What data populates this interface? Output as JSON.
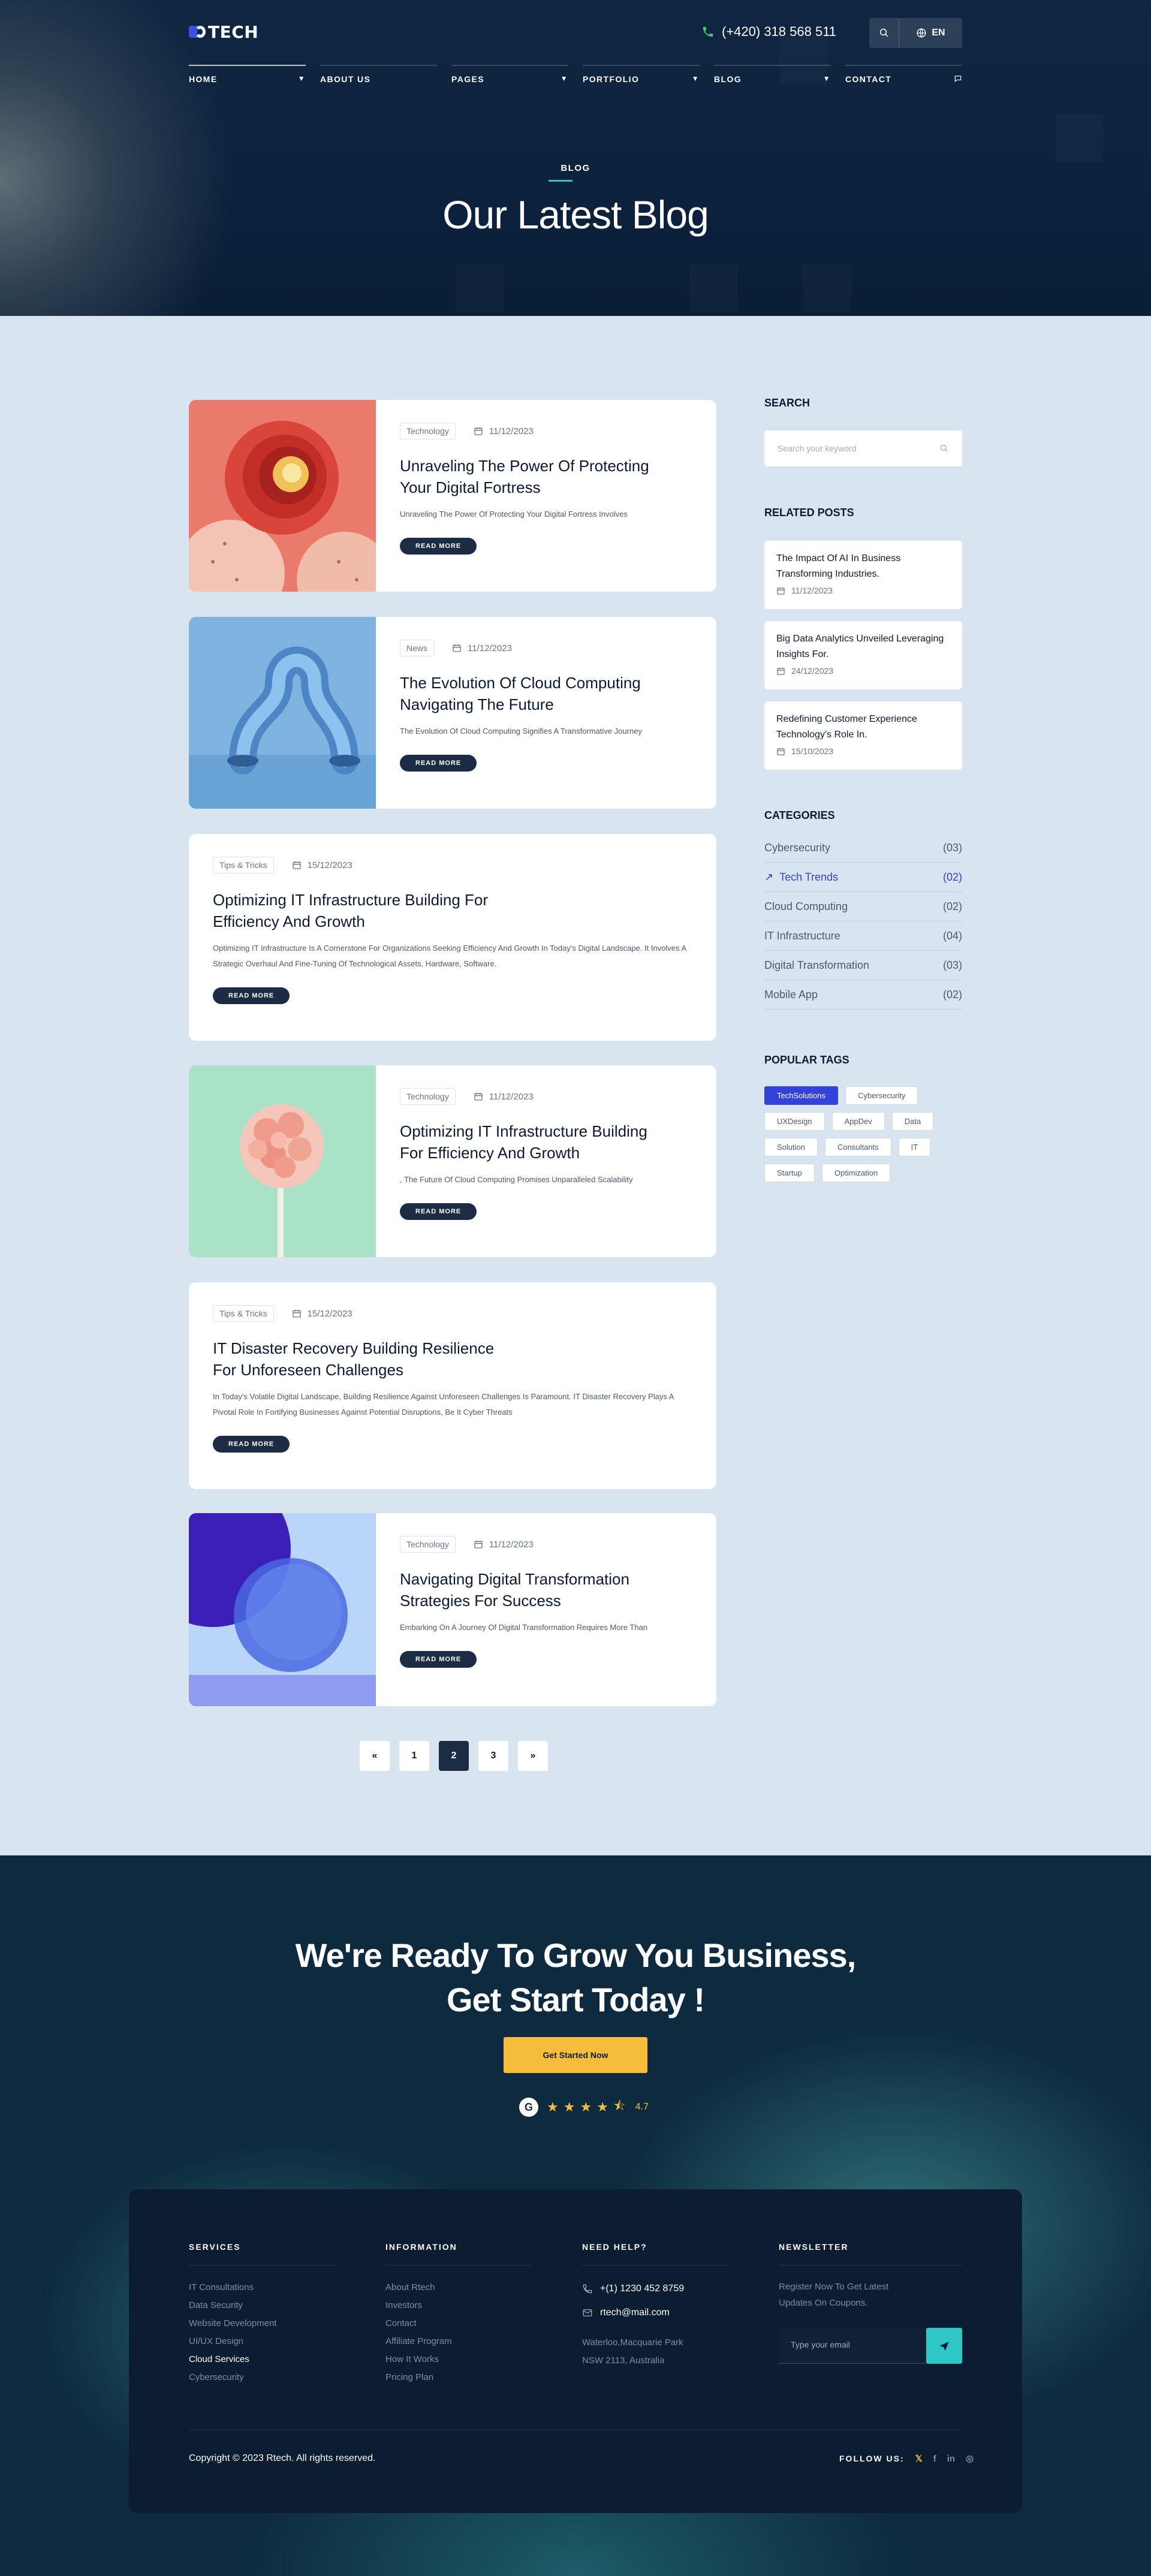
{
  "header": {
    "logo_text": "TECH",
    "phone": "(+420) 318 568 511",
    "lang": "EN",
    "nav": [
      {
        "label": "HOME",
        "dropdown": true
      },
      {
        "label": "ABOUT US",
        "dropdown": false
      },
      {
        "label": "PAGES",
        "dropdown": true
      },
      {
        "label": "PORTFOLIO",
        "dropdown": true
      },
      {
        "label": "BLOG",
        "dropdown": true
      },
      {
        "label": "CONTACT",
        "dropdown": false
      }
    ]
  },
  "hero": {
    "kicker": "BLOG",
    "title": "Our Latest Blog"
  },
  "posts": [
    {
      "tag": "Technology",
      "date": "11/12/2023",
      "title": "Unraveling The Power Of Protecting Your Digital Fortress",
      "desc": "Unraveling The Power Of Protecting Your Digital Fortress Involves",
      "btn": "READ MORE"
    },
    {
      "tag": "News",
      "date": "11/12/2023",
      "title": "The Evolution Of Cloud Computing Navigating The Future",
      "desc": "The Evolution Of Cloud Computing Signifies A Transformative Journey",
      "btn": "READ MORE"
    },
    {
      "tag": "Tips & Tricks",
      "date": "15/12/2023",
      "title": "Optimizing IT Infrastructure Building For Efficiency And Growth",
      "desc": "Optimizing IT Infrastructure Is A Cornerstone For Organizations Seeking Efficiency And Growth In Today's Digital Landscape. It Involves A Strategic Overhaul And Fine-Tuning Of Technological Assets, Hardware, Software.",
      "btn": "READ MORE"
    },
    {
      "tag": "Technology",
      "date": "11/12/2023",
      "title": "Optimizing IT Infrastructure Building For Efficiency And Growth",
      "desc": ", The Future Of Cloud Computing Promises Unparalleled Scalability",
      "btn": "READ MORE"
    },
    {
      "tag": "Tips & Tricks",
      "date": "15/12/2023",
      "title": "IT Disaster Recovery Building Resilience For Unforeseen Challenges",
      "desc": "In Today's Volatile Digital Landscape, Building Resilience Against Unforeseen Challenges Is Paramount. IT Disaster Recovery Plays A Pivotal Role In Fortifying Businesses Against Potential Disruptions, Be It Cyber Threats",
      "btn": "READ MORE"
    },
    {
      "tag": "Technology",
      "date": "11/12/2023",
      "title": "Navigating Digital Transformation Strategies For Success",
      "desc": "Embarking On A Journey Of Digital Transformation Requires More Than",
      "btn": "READ MORE"
    }
  ],
  "pagination": {
    "prev": "«",
    "pages": [
      "1",
      "2",
      "3"
    ],
    "current": "2",
    "next": "»"
  },
  "sidebar": {
    "search_title": "SEARCH",
    "search_placeholder": "Search your keyword",
    "related_title": "RELATED POSTS",
    "related": [
      {
        "title": "The Impact Of AI In Business Transforming Industries.",
        "date": "11/12/2023"
      },
      {
        "title": "Big Data Analytics Unveiled Leveraging Insights For.",
        "date": "24/12/2023"
      },
      {
        "title": "Redefining Customer Experience Technology's Role In.",
        "date": "15/10/2023"
      }
    ],
    "categories_title": "CATEGORIES",
    "categories": [
      {
        "name": "Cybersecurity",
        "count": "(03)"
      },
      {
        "name": "Tech Trends",
        "count": "(02)",
        "active": true
      },
      {
        "name": "Cloud Computing",
        "count": "(02)"
      },
      {
        "name": "IT Infrastructure",
        "count": "(04)"
      },
      {
        "name": "Digital Transformation",
        "count": "(03)"
      },
      {
        "name": "Mobile App",
        "count": "(02)"
      }
    ],
    "tags_title": "POPULAR TAGS",
    "tags": [
      "TechSolutions",
      "Cybersecurity",
      "UXDesign",
      "AppDev",
      "Data",
      "Solution",
      "Consultants",
      "IT",
      "Startup",
      "Optimization"
    ]
  },
  "cta": {
    "title_line1": "We're Ready To Grow You Business,",
    "title_line2": "Get Start Today !",
    "button": "Get Started Now",
    "rating_badge": "G",
    "rating_value": "4.7",
    "stars": 4.5
  },
  "footer": {
    "services_title": "SERVICES",
    "services": [
      "IT Consultations",
      "Data Security",
      "Website Development",
      "UI/UX Design",
      "Cloud Services",
      "Cybersecurity"
    ],
    "info_title": "INFORMATION",
    "info": [
      "About Rtech",
      "Investors",
      "Contact",
      "Affiliate Program",
      "How It Works",
      "Pricing Plan"
    ],
    "help_title": "NEED HELP?",
    "help_phone": "+(1) 1230 452 8759",
    "help_email": "rtech@mail.com",
    "help_addr1": "Waterloo,Macquarie Park",
    "help_addr2": "NSW 2113, Australia",
    "newsletter_title": "NEWSLETTER",
    "newsletter_text": "Register Now To Get Latest Updates On Coupons.",
    "newsletter_placeholder": "Type your email",
    "copyright": "Copyright © 2023 Rtech. All rights reserved.",
    "follow": "FOLLOW US:",
    "social": [
      "𝕏",
      "f",
      "in",
      "◎"
    ]
  },
  "colors": {
    "accent": "#3342d8",
    "dark": "#1c2c44",
    "yellow": "#f6bd3c",
    "teal": "#2fc6c6"
  }
}
